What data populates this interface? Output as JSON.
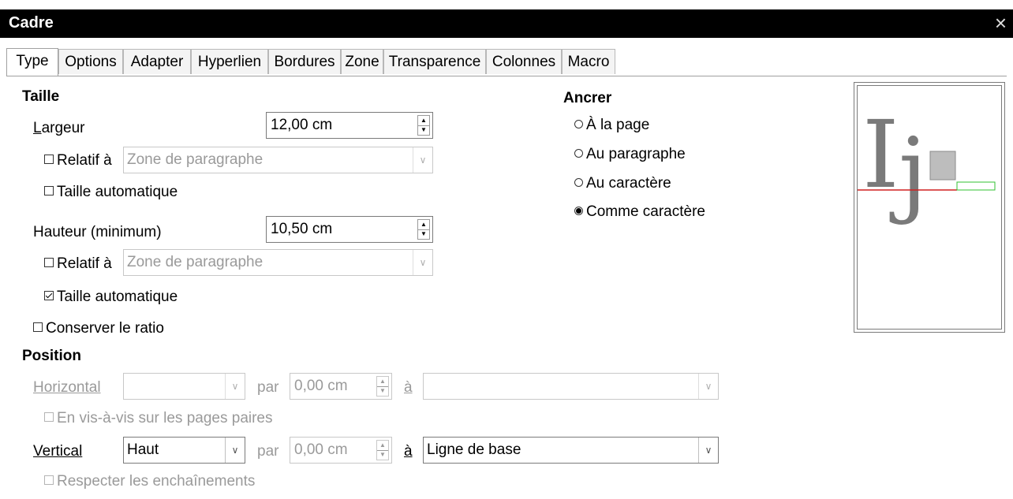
{
  "window": {
    "title": "Cadre",
    "close_glyph": "×"
  },
  "tabs": [
    {
      "label": "Type",
      "active": true
    },
    {
      "label": "Options"
    },
    {
      "label": "Adapter"
    },
    {
      "label": "Hyperlien"
    },
    {
      "label": "Bordures"
    },
    {
      "label": "Zone"
    },
    {
      "label": "Transparence"
    },
    {
      "label": "Colonnes"
    },
    {
      "label": "Macro"
    }
  ],
  "size": {
    "heading": "Taille",
    "width": {
      "label": "Largeur",
      "value": "12,00 cm",
      "relative_label": "Relatif à",
      "relative_checked": false,
      "relative_value": "Zone de paragraphe",
      "auto_label": "Taille automatique",
      "auto_checked": false
    },
    "height": {
      "label": "Hauteur (minimum)",
      "value": "10,50 cm",
      "relative_label": "Relatif à",
      "relative_checked": false,
      "relative_value": "Zone de paragraphe",
      "auto_label": "Taille automatique",
      "auto_checked": true
    },
    "keep_ratio_label": "Conserver le ratio",
    "keep_ratio_checked": false
  },
  "anchor": {
    "heading": "Ancrer",
    "options": [
      {
        "label": "À la page",
        "selected": false
      },
      {
        "label": "Au paragraphe",
        "selected": false
      },
      {
        "label": "Au caractère",
        "selected": false
      },
      {
        "label": "Comme caractère",
        "selected": true
      }
    ]
  },
  "position": {
    "heading": "Position",
    "horizontal": {
      "label": "Horizontal",
      "value": "",
      "by_label": "par",
      "by_value": "0,00 cm",
      "to_label": "à",
      "to_value": ""
    },
    "mirror_label": "En vis-à-vis sur les pages paires",
    "vertical": {
      "label": "Vertical",
      "value": "Haut",
      "by_label": "par",
      "by_value": "0,00 cm",
      "to_label": "à",
      "to_value": "Ligne de base"
    },
    "follow_flow_label": "Respecter les enchaînements"
  },
  "preview": {
    "glyph_I": "I",
    "glyph_j": "j"
  },
  "icons": {
    "spin_up": "▲",
    "spin_down": "▼",
    "dropdown": "∨"
  }
}
